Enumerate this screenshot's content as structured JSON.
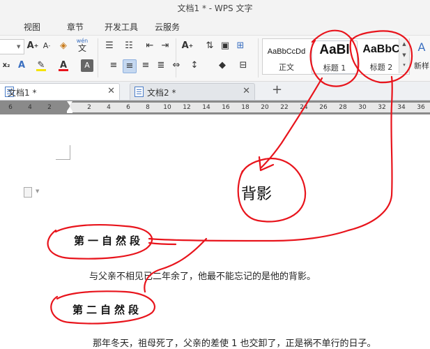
{
  "window": {
    "title": "文档1 * - WPS 文字"
  },
  "menu": {
    "items": [
      "视图",
      "章节",
      "开发工具",
      "云服务"
    ]
  },
  "ribbon": {
    "styles": [
      {
        "preview": "AaBbCcDd",
        "name": "正文"
      },
      {
        "preview": "AaBl",
        "name": "标题 1"
      },
      {
        "preview": "AaBbC",
        "name": "标题 2"
      }
    ],
    "new_style_label": "新样",
    "wen_label": "wén",
    "wen_char": "文"
  },
  "tabs": [
    {
      "label": "文档1 *"
    },
    {
      "label": "文档2 *"
    }
  ],
  "ruler": {
    "ticks": [
      "6",
      "4",
      "2",
      "2",
      "4",
      "6",
      "8",
      "10",
      "12",
      "14",
      "16",
      "18",
      "20",
      "22",
      "24",
      "26",
      "28",
      "30",
      "32",
      "34",
      "36"
    ]
  },
  "document": {
    "annotation": "背影",
    "heading1": "第一自然段",
    "para1": "与父亲不相见已二年余了，他最不能忘记的是他的背影。",
    "heading2": "第二自然段",
    "para2": "那年冬天，祖母死了，父亲的差使 1 也交卸了，正是祸不单行的日子。"
  },
  "colors": {
    "annotation_ink": "#e8141c",
    "accent": "#3a6fc0"
  }
}
